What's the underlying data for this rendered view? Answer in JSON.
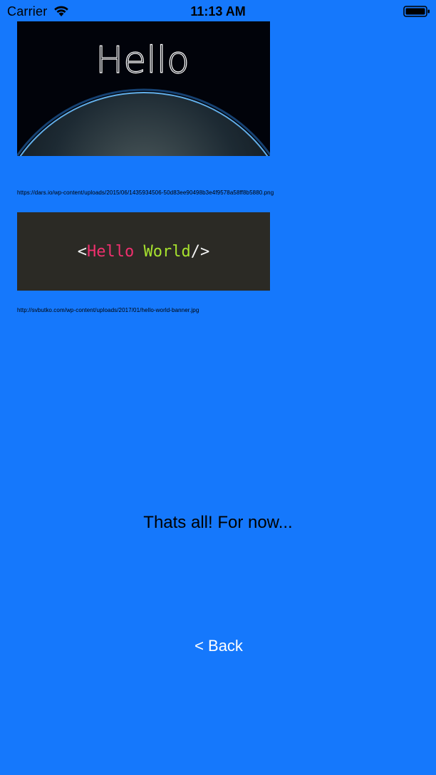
{
  "status_bar": {
    "carrier": "Carrier",
    "time": "11:13 AM",
    "icons": [
      "wifi-icon",
      "battery-icon"
    ]
  },
  "images": [
    {
      "text": "Hello",
      "url": "https://dars.io/wp-content/uploads/2015/06/1435934506-50d83ee90498b3e4f9578a58ff8b5880.png"
    },
    {
      "code_open": "<",
      "code_hello": "Hello",
      "code_world": "World",
      "code_close": "/>",
      "url": "http://svbutko.com/wp-content/uploads/2017/01/hello-world-banner.jpg"
    }
  ],
  "closing_text": "Thats all! For now...",
  "back_button_label": "< Back",
  "colors": {
    "background": "#1578fc",
    "back_button_text": "#ffffff",
    "code_background": "#2b2a25",
    "code_hello": "#f0306e",
    "code_world": "#a7e22e"
  }
}
